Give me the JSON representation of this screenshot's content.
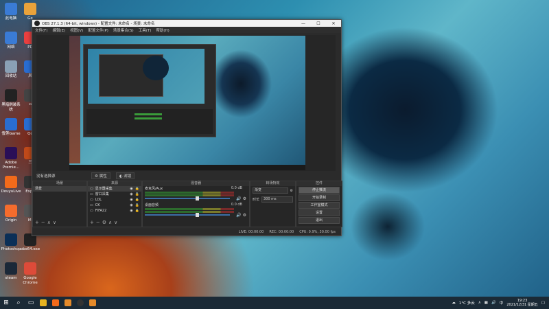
{
  "desktop_icons": [
    {
      "label": "此电脑",
      "color": "#3a7bd5"
    },
    {
      "label": "网络",
      "color": "#3a7bd5"
    },
    {
      "label": "回收站",
      "color": "#8aa0b5"
    },
    {
      "label": "黑暗刷装系统",
      "color": "#222"
    },
    {
      "label": "雪莲Game",
      "color": "#2a6dd1"
    },
    {
      "label": "Adobe Premie...",
      "color": "#2a0f57"
    },
    {
      "label": "DouyuLive",
      "color": "#f26a1b"
    },
    {
      "label": "Origin",
      "color": "#f56c2d"
    },
    {
      "label": "Photoshop",
      "color": "#0b2f57"
    },
    {
      "label": "steam",
      "color": "#1b2838"
    }
  ],
  "desktop_icons_col2": [
    {
      "label": "Ge",
      "color": "#e9a23b"
    },
    {
      "label": "PD",
      "color": "#e94040"
    },
    {
      "label": "风",
      "color": "#2a6dd1"
    },
    {
      "label": "ㅁ",
      "color": "#444"
    },
    {
      "label": "Qo",
      "color": "#2a6dd1"
    },
    {
      "label": "三",
      "color": "#c04a1a"
    },
    {
      "label": "Expe",
      "color": "#333"
    },
    {
      "label": "Mi",
      "color": "#555"
    },
    {
      "label": "obs64.exe",
      "color": "#222"
    },
    {
      "label": "Google Chrome",
      "color": "#dd4b39"
    }
  ],
  "obs": {
    "title": "OBS 27.1.3 (64-bit, windows) - 配置文件: 未命名 - 场景: 未命名",
    "menu": [
      "文件(F)",
      "编辑(E)",
      "视图(V)",
      "配置文件(P)",
      "场景集合(S)",
      "工具(T)",
      "帮助(H)"
    ],
    "dock_titles": {
      "scenes": "场景",
      "sources": "来源",
      "mixer": "混音器",
      "transitions": "转场特效",
      "controls": "控件"
    },
    "scene_bar": "没有选择源",
    "props_button": "属性",
    "filters_button": "滤镜",
    "scenes": [
      "场景"
    ],
    "sources": [
      {
        "label": "显示器采集",
        "icon": "monitor-icon"
      },
      {
        "label": "窗口采集",
        "icon": "window-icon"
      },
      {
        "label": "LOL",
        "icon": "monitor-icon"
      },
      {
        "label": "CK",
        "icon": "monitor-icon"
      },
      {
        "label": "FIFA22",
        "icon": "monitor-icon"
      }
    ],
    "mixer": [
      {
        "name": "麦克风/Aux",
        "db": "0.0 dB",
        "level": 0.6
      },
      {
        "name": "桌面音频",
        "db": "0.0 dB",
        "level": 0.6
      }
    ],
    "transitions": {
      "type": "渐变",
      "duration_label": "时长",
      "duration": "300 ms"
    },
    "controls": [
      "停止推流",
      "开始录制",
      "工作室模式",
      "设置",
      "退出"
    ],
    "status": [
      "LIVE: 00:00:00",
      "REC: 00:00:00",
      "CPU: 0.9%, 30.00 fps"
    ]
  },
  "taskbar": {
    "weather": "1°C 多云",
    "time": "19:23",
    "date": "2021/12/31 星期五"
  }
}
